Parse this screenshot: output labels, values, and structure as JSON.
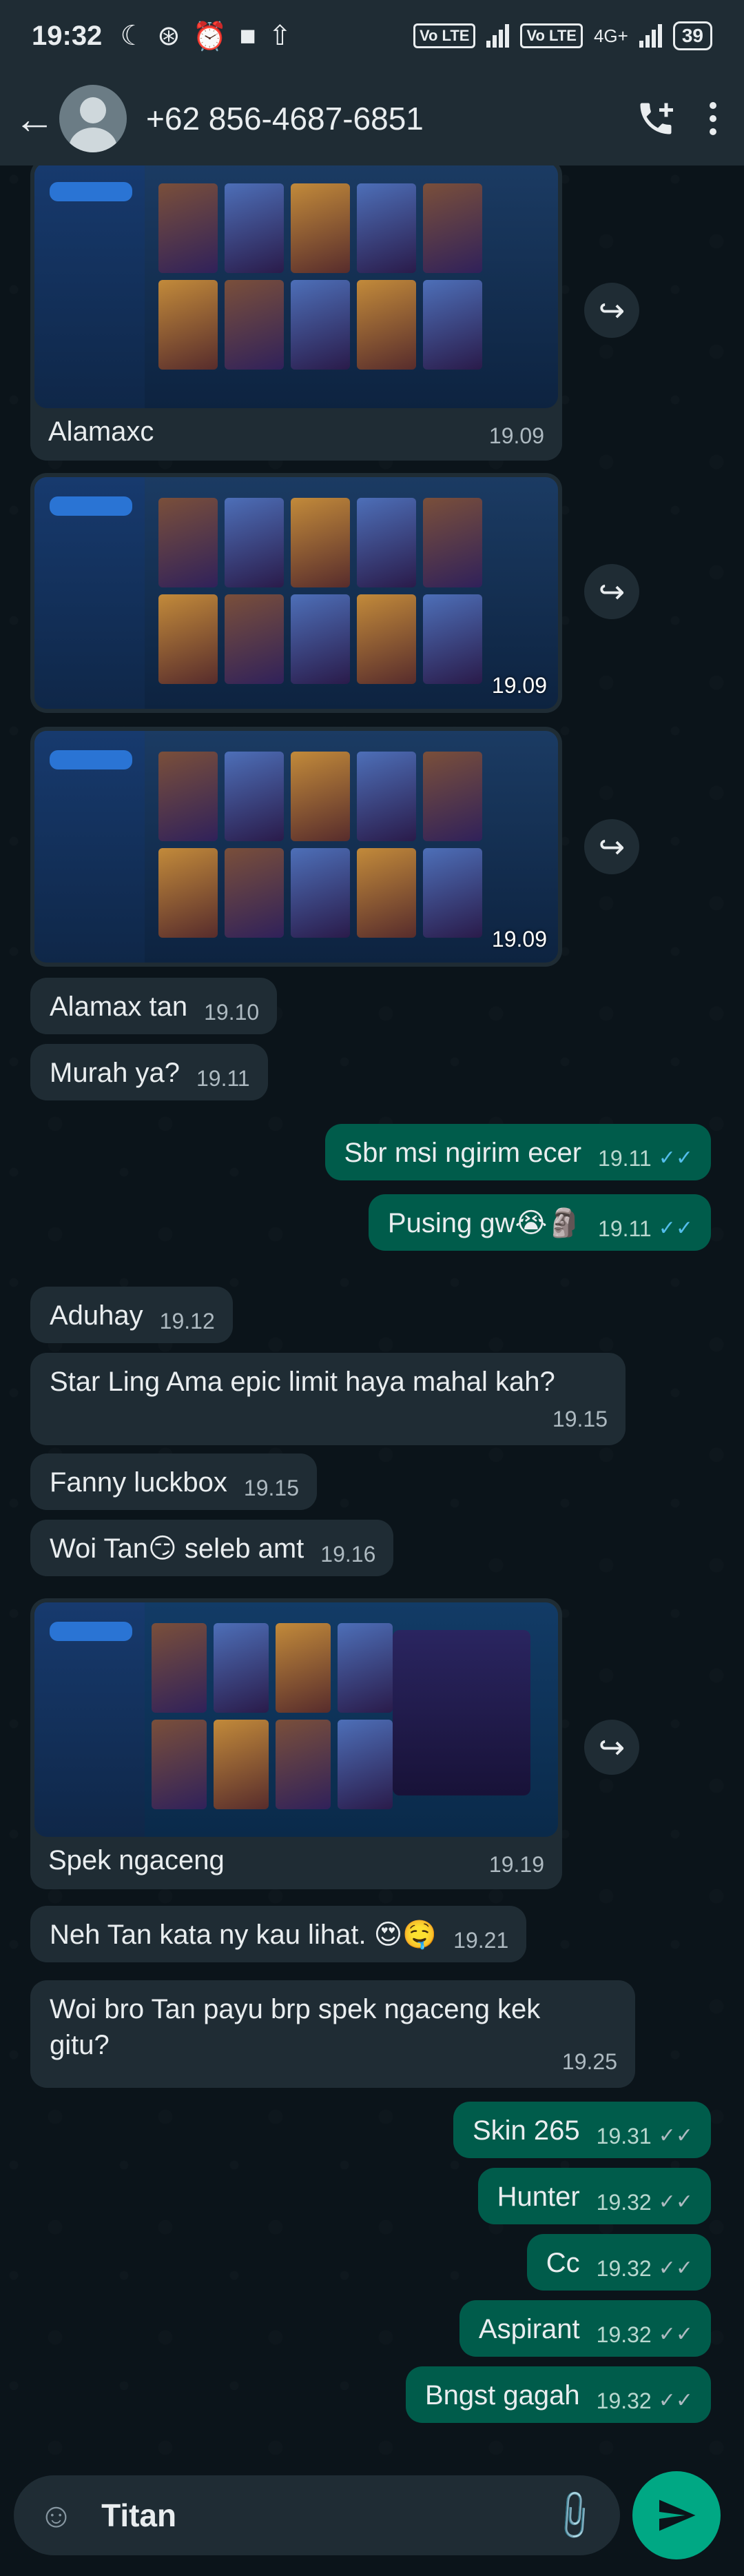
{
  "status_bar": {
    "time": "19:32",
    "volte_1": "Vo LTE",
    "volte_2": "Vo LTE",
    "network": "4G+",
    "battery": "39"
  },
  "header": {
    "contact_name": "+62 856-4687-6851"
  },
  "messages": [
    {
      "id": "m1",
      "direction": "incoming",
      "type": "image",
      "caption": "Alamaxc",
      "time": "19.09"
    },
    {
      "id": "m2",
      "direction": "incoming",
      "type": "image",
      "caption": "",
      "time": "19.09"
    },
    {
      "id": "m3",
      "direction": "incoming",
      "type": "image",
      "caption": "",
      "time": "19.09"
    },
    {
      "id": "m4",
      "direction": "incoming",
      "type": "text",
      "text": "Alamax tan",
      "time": "19.10"
    },
    {
      "id": "m5",
      "direction": "incoming",
      "type": "text",
      "text": "Murah ya?",
      "time": "19.11"
    },
    {
      "id": "m6",
      "direction": "outgoing",
      "type": "text",
      "text": "Sbr msi ngirim ecer",
      "time": "19.11",
      "status": "read"
    },
    {
      "id": "m7",
      "direction": "outgoing",
      "type": "text",
      "text": "Pusing gw😭🗿",
      "time": "19.11",
      "status": "read"
    },
    {
      "id": "m8",
      "direction": "incoming",
      "type": "text",
      "text": "Aduhay",
      "time": "19.12"
    },
    {
      "id": "m9",
      "direction": "incoming",
      "type": "text",
      "text": "Star Ling Ama epic limit haya mahal kah?",
      "time": "19.15"
    },
    {
      "id": "m10",
      "direction": "incoming",
      "type": "text",
      "text": "Fanny luckbox",
      "time": "19.15"
    },
    {
      "id": "m11",
      "direction": "incoming",
      "type": "text",
      "text": "Woi Tan😏 seleb amt",
      "time": "19.16"
    },
    {
      "id": "m12",
      "direction": "incoming",
      "type": "image",
      "caption": "Spek ngaceng",
      "time": "19.19"
    },
    {
      "id": "m13",
      "direction": "incoming",
      "type": "text",
      "text": "Neh Tan kata ny kau lihat. 😍🤤",
      "time": "19.21"
    },
    {
      "id": "m14",
      "direction": "incoming",
      "type": "text",
      "text": "Woi bro Tan payu brp spek ngaceng kek gitu?",
      "time": "19.25"
    },
    {
      "id": "m15",
      "direction": "outgoing",
      "type": "text",
      "text": "Skin 265",
      "time": "19.31",
      "status": "delivered"
    },
    {
      "id": "m16",
      "direction": "outgoing",
      "type": "text",
      "text": "Hunter",
      "time": "19.32",
      "status": "delivered"
    },
    {
      "id": "m17",
      "direction": "outgoing",
      "type": "text",
      "text": "Cc",
      "time": "19.32",
      "status": "delivered"
    },
    {
      "id": "m18",
      "direction": "outgoing",
      "type": "text",
      "text": "Aspirant",
      "time": "19.32",
      "status": "delivered"
    },
    {
      "id": "m19",
      "direction": "outgoing",
      "type": "text",
      "text": "Bngst gagah",
      "time": "19.32",
      "status": "delivered"
    }
  ],
  "input": {
    "value": "Titan"
  },
  "icons": {
    "back": "arrow-left-icon",
    "call": "add-call-icon",
    "menu": "more-vertical-icon",
    "sticker": "sticker-icon",
    "attach": "paperclip-icon",
    "send": "send-icon",
    "forward": "forward-icon",
    "read": "double-check-blue-icon",
    "delivered": "double-check-grey-icon"
  },
  "colors": {
    "background": "#0b141a",
    "header": "#1f2c34",
    "incoming_bubble": "#1f2c34",
    "outgoing_bubble": "#005c4b",
    "accent": "#00a884",
    "read_ticks": "#53bdeb"
  }
}
